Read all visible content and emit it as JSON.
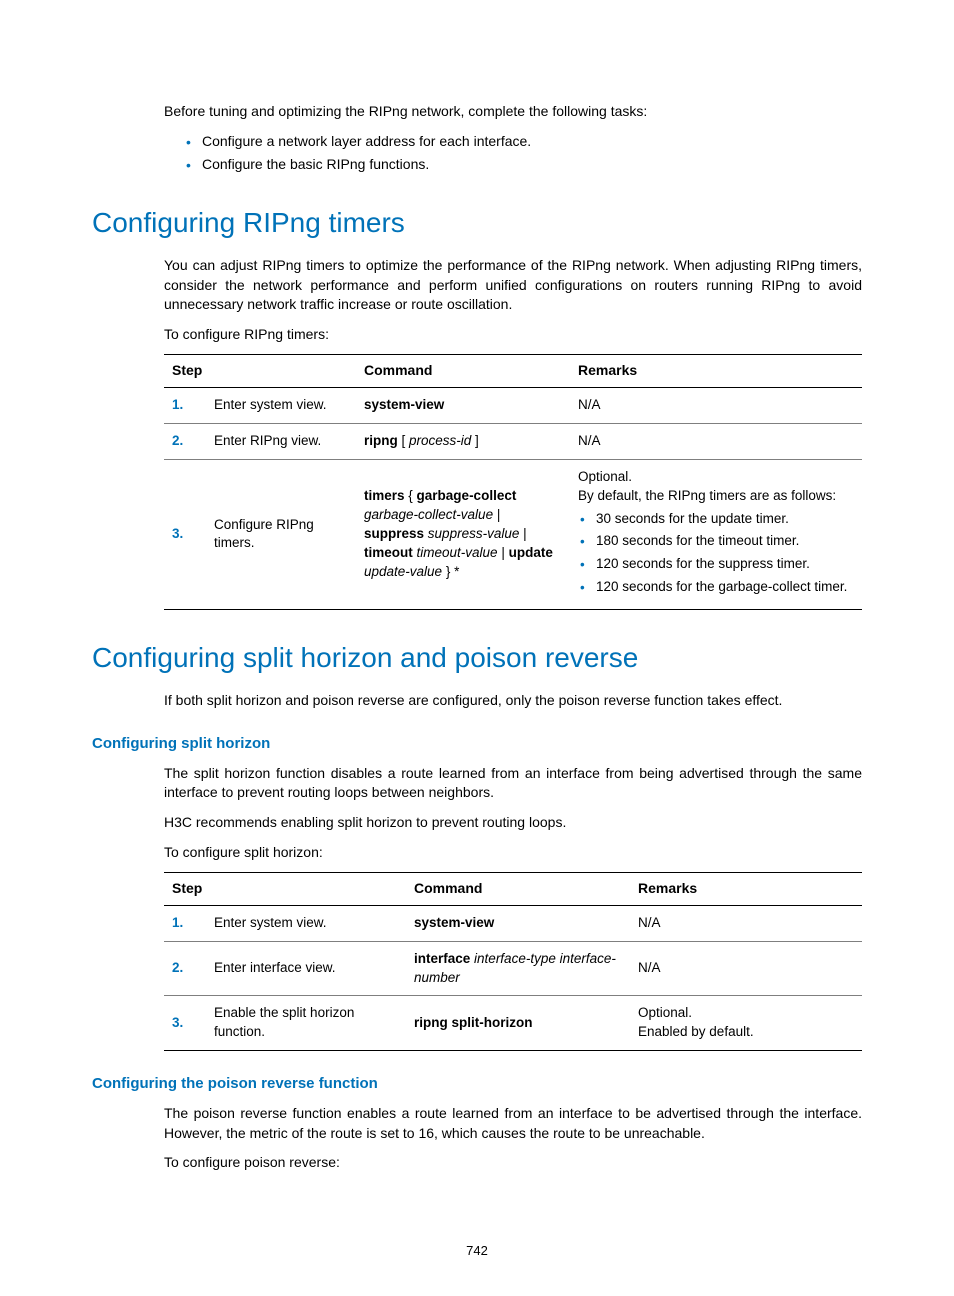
{
  "intro": {
    "lead": "Before tuning and optimizing the RIPng network, complete the following tasks:",
    "bullets": [
      "Configure a network layer address for each interface.",
      "Configure the basic RIPng functions."
    ]
  },
  "section_timers": {
    "title": "Configuring RIPng timers",
    "para": "You can adjust RIPng timers to optimize the performance of the RIPng network. When adjusting RIPng timers, consider the network performance and perform unified configurations on routers running RIPng to avoid unnecessary network traffic increase or route oscillation.",
    "lead": "To configure RIPng timers:",
    "table": {
      "headers": {
        "step": "Step",
        "command": "Command",
        "remarks": "Remarks"
      },
      "rows": [
        {
          "num": "1.",
          "step": "Enter system view.",
          "command_html": "<strong>system-view</strong>",
          "remarks_html": "N/A"
        },
        {
          "num": "2.",
          "step": "Enter RIPng view.",
          "command_html": "<strong>ripng</strong> [ <em>process-id</em> ]",
          "remarks_html": "N/A"
        },
        {
          "num": "3.",
          "step": "Configure RIPng timers.",
          "command_html": "<strong>timers</strong> { <strong>garbage-collect</strong> <em>garbage-collect-value</em> | <strong>suppress</strong> <em>suppress-value</em> | <strong>timeout</strong> <em>timeout-value</em> | <strong>update</strong> <em>update-value</em> } *",
          "remarks_html": "Optional.<br>By default, the RIPng timers are as follows:<ul class='bull' style='margin:4px 0 0 0; padding-left:18px;'><li>30 seconds for the update timer.</li><li>180 seconds for the timeout timer.</li><li>120 seconds for the suppress timer.</li><li>120 seconds for the garbage-collect timer.</li></ul>"
        }
      ]
    }
  },
  "section_split": {
    "title": "Configuring split horizon and poison reverse",
    "para": "If both split horizon and poison reverse are configured, only the poison reverse function takes effect.",
    "sub_split": {
      "title": "Configuring split horizon",
      "para1": "The split horizon function disables a route learned from an interface from being advertised through the same interface to prevent routing loops between neighbors.",
      "para2": "H3C recommends enabling split horizon to prevent routing loops.",
      "lead": "To configure split horizon:",
      "table": {
        "headers": {
          "step": "Step",
          "command": "Command",
          "remarks": "Remarks"
        },
        "rows": [
          {
            "num": "1.",
            "step": "Enter system view.",
            "command_html": "<strong>system-view</strong>",
            "remarks_html": "N/A"
          },
          {
            "num": "2.",
            "step": "Enter interface view.",
            "command_html": "<strong>interface</strong> <em>interface-type interface-number</em>",
            "remarks_html": "N/A"
          },
          {
            "num": "3.",
            "step": "Enable the split horizon function.",
            "command_html": "<strong>ripng split-horizon</strong>",
            "remarks_html": "Optional.<br>Enabled by default."
          }
        ]
      }
    },
    "sub_poison": {
      "title": "Configuring the poison reverse function",
      "para": "The poison reverse function enables a route learned from an interface to be advertised through the interface. However, the metric of the route is set to 16, which causes the route to be unreachable.",
      "lead": "To configure poison reverse:"
    }
  },
  "page_number": "742"
}
